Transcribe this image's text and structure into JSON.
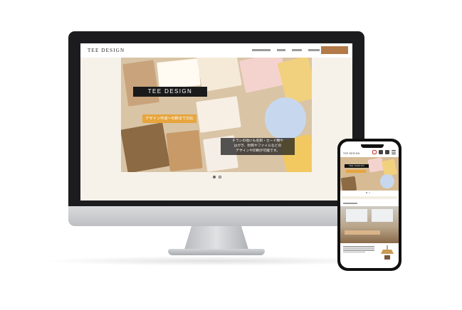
{
  "site": {
    "logo": "TEE DESIGN",
    "nav": [
      "",
      "",
      "",
      ""
    ],
    "cta_label": ""
  },
  "hero": {
    "title": "TEE DESIGN",
    "subtitle": "デザイン作成〜印刷まで対応",
    "description_lines": [
      "チラシの他にも名刺・カード類や",
      "はがき、封筒やファイルなどの",
      "デザインや印刷が可能です。"
    ],
    "slides": 2,
    "active_slide": 1
  },
  "phone_site": {
    "logo": "TEE DESIGN"
  },
  "colors": {
    "accent": "#b17a48",
    "hero_badge": "#e7a53b",
    "screen_bg": "#f6f2e9"
  }
}
